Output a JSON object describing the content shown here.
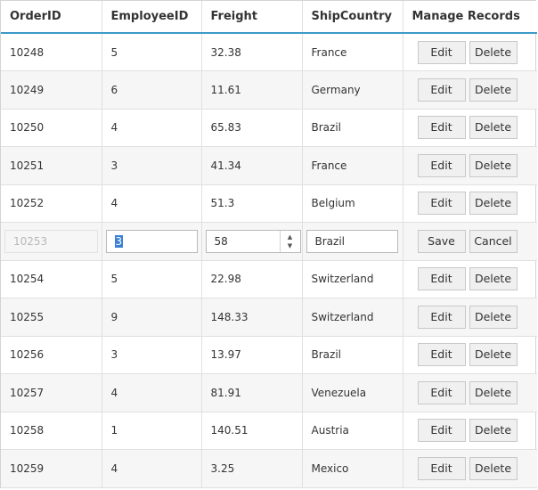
{
  "headers": {
    "order_id": "OrderID",
    "employee_id": "EmployeeID",
    "freight": "Freight",
    "ship_country": "ShipCountry",
    "manage": "Manage Records"
  },
  "buttons": {
    "edit": "Edit",
    "delete": "Delete",
    "save": "Save",
    "cancel": "Cancel"
  },
  "rows": [
    {
      "order_id": "10248",
      "employee_id": "5",
      "freight": "32.38",
      "ship_country": "France"
    },
    {
      "order_id": "10249",
      "employee_id": "6",
      "freight": "11.61",
      "ship_country": "Germany"
    },
    {
      "order_id": "10250",
      "employee_id": "4",
      "freight": "65.83",
      "ship_country": "Brazil"
    },
    {
      "order_id": "10251",
      "employee_id": "3",
      "freight": "41.34",
      "ship_country": "France"
    },
    {
      "order_id": "10252",
      "employee_id": "4",
      "freight": "51.3",
      "ship_country": "Belgium"
    },
    {
      "order_id": "10253",
      "employee_id": "3",
      "freight": "58",
      "ship_country": "Brazil"
    },
    {
      "order_id": "10254",
      "employee_id": "5",
      "freight": "22.98",
      "ship_country": "Switzerland"
    },
    {
      "order_id": "10255",
      "employee_id": "9",
      "freight": "148.33",
      "ship_country": "Switzerland"
    },
    {
      "order_id": "10256",
      "employee_id": "3",
      "freight": "13.97",
      "ship_country": "Brazil"
    },
    {
      "order_id": "10257",
      "employee_id": "4",
      "freight": "81.91",
      "ship_country": "Venezuela"
    },
    {
      "order_id": "10258",
      "employee_id": "1",
      "freight": "140.51",
      "ship_country": "Austria"
    },
    {
      "order_id": "10259",
      "employee_id": "4",
      "freight": "3.25",
      "ship_country": "Mexico"
    }
  ],
  "colors": {
    "header_border": "#3c9ac7",
    "alt_row": "#f6f6f6"
  }
}
